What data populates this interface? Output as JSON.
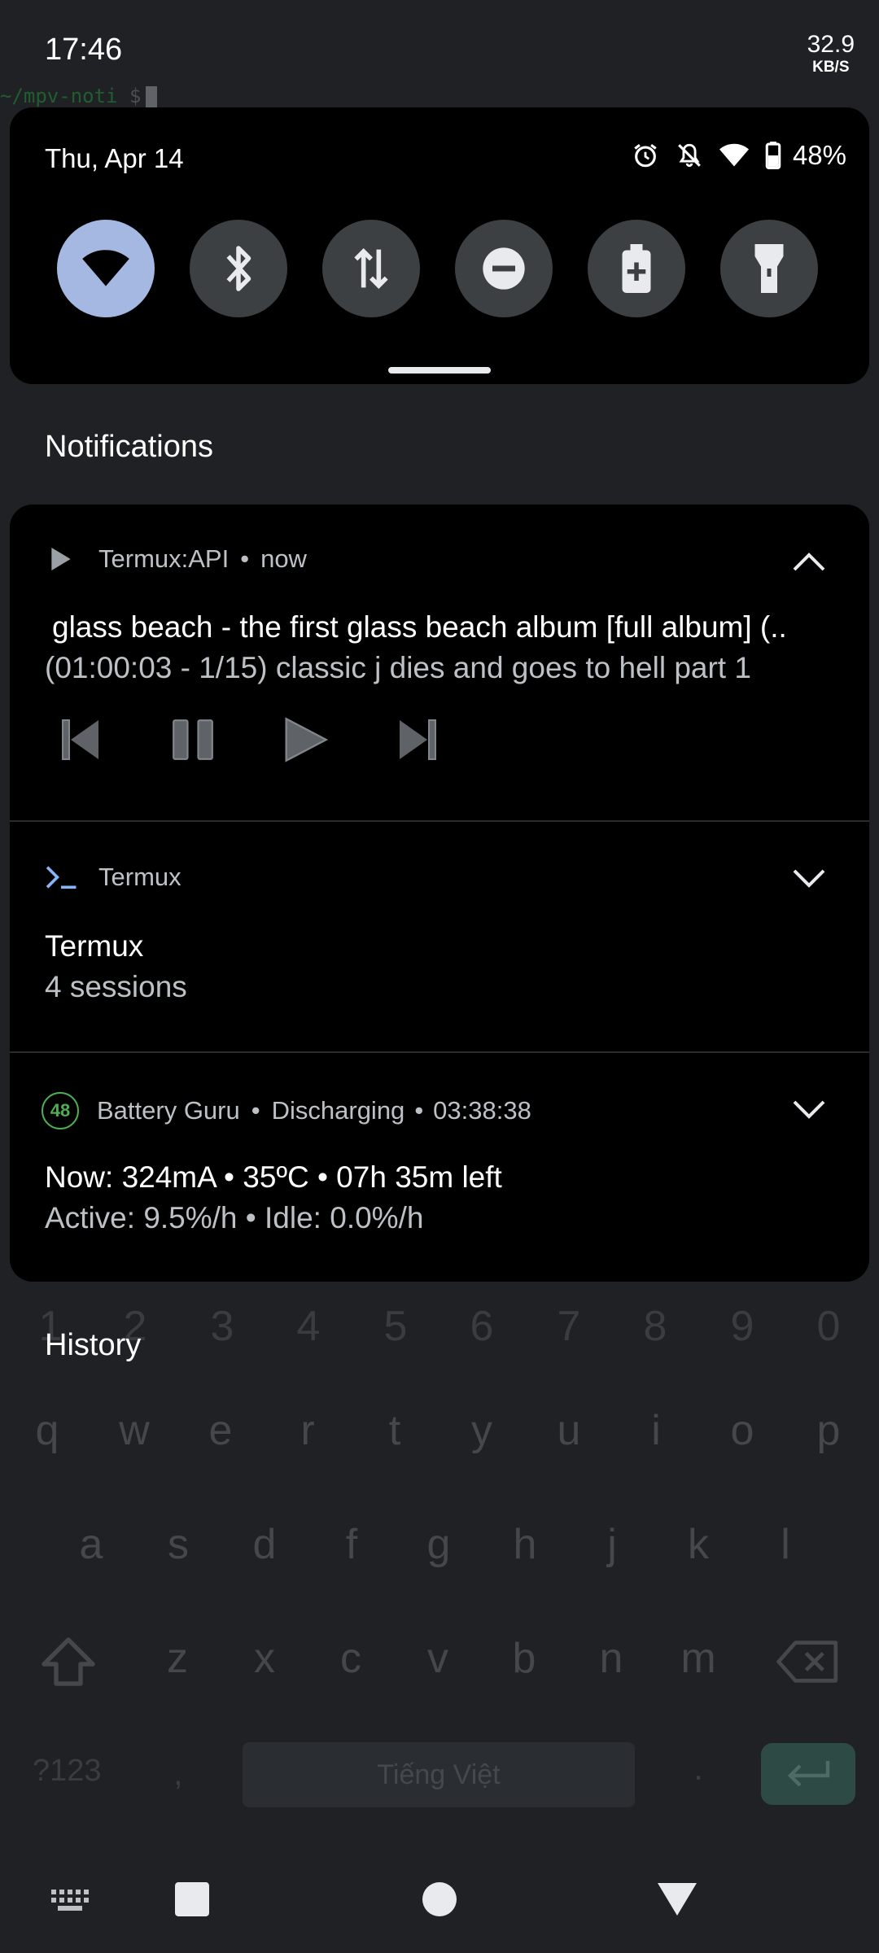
{
  "status_bar": {
    "time": "17:46",
    "net_speed_value": "32.9",
    "net_speed_unit": "KB/S"
  },
  "terminal": {
    "prompt_path": "~/mpv-noti",
    "prompt_symbol": "$"
  },
  "quick_settings": {
    "date": "Thu, Apr 14",
    "battery_percent": "48%",
    "status_icons": [
      "alarm-icon",
      "notifications-off-icon",
      "wifi-icon",
      "battery-icon"
    ],
    "tiles": [
      {
        "name": "wifi",
        "icon": "wifi-icon",
        "active": true
      },
      {
        "name": "bluetooth",
        "icon": "bluetooth-icon",
        "active": false
      },
      {
        "name": "mobile-data",
        "icon": "data-arrows-icon",
        "active": false
      },
      {
        "name": "do-not-disturb",
        "icon": "do-not-disturb-icon",
        "active": false
      },
      {
        "name": "battery-saver",
        "icon": "battery-saver-icon",
        "active": false
      },
      {
        "name": "flashlight",
        "icon": "flashlight-icon",
        "active": false
      }
    ],
    "accent_color": "#a4b8e1"
  },
  "notifications": {
    "header": "Notifications",
    "items": [
      {
        "app": "Termux:API",
        "time": "now",
        "title": "glass beach - the first glass beach album [full album] (..",
        "text": "(01:00:03 - 1/15) classic j dies and goes to hell part 1",
        "controls": [
          "previous-icon",
          "pause-icon",
          "play-icon",
          "next-icon"
        ]
      },
      {
        "app": "Termux",
        "title": "Termux",
        "text": "4 sessions"
      },
      {
        "app": "Battery Guru",
        "badge": "48",
        "status": "Discharging",
        "time": "03:38:38",
        "title": "Now: 324mA • 35ºC • 07h 35m left",
        "text": "Active: 9.5%/h • Idle: 0.0%/h",
        "badge_color": "#4caf50"
      }
    ]
  },
  "history": {
    "label": "History"
  },
  "keyboard": {
    "numbers": [
      "1",
      "2",
      "3",
      "4",
      "5",
      "6",
      "7",
      "8",
      "9",
      "0"
    ],
    "row1": [
      "q",
      "w",
      "e",
      "r",
      "t",
      "y",
      "u",
      "i",
      "o",
      "p"
    ],
    "row2": [
      "a",
      "s",
      "d",
      "f",
      "g",
      "h",
      "j",
      "k",
      "l"
    ],
    "row3": [
      "z",
      "x",
      "c",
      "v",
      "b",
      "n",
      "m"
    ],
    "symbols_key": "?123",
    "comma_key": ",",
    "space_label": "Tiếng Việt",
    "period_key": "."
  },
  "nav_bar": {
    "buttons": [
      "keyboard-icon",
      "recents-icon",
      "home-icon",
      "back-icon"
    ]
  }
}
